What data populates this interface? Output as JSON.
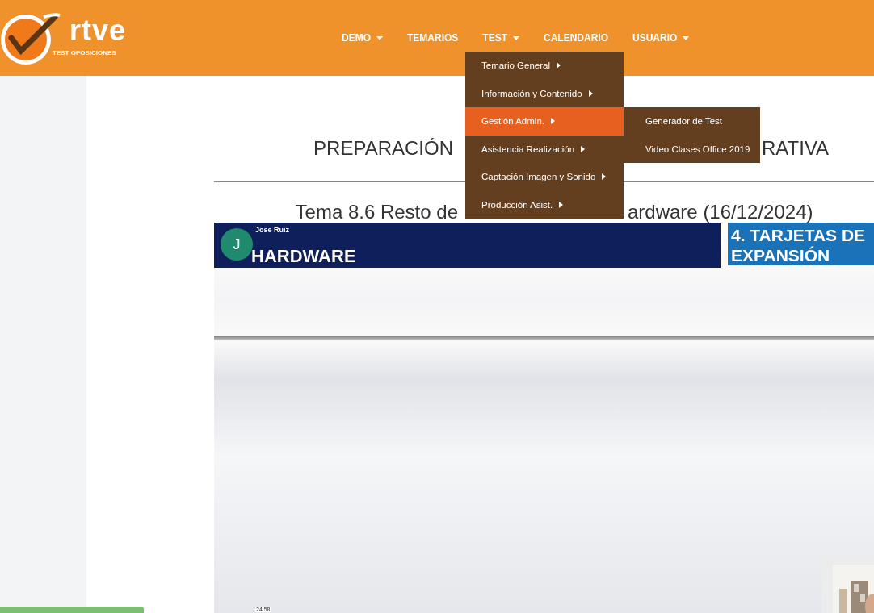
{
  "logo": {
    "wordmark": "rtve",
    "tagline": "TEST OPOSICIONES"
  },
  "nav": [
    {
      "label": "DEMO",
      "caret": true
    },
    {
      "label": "TEMARIOS",
      "caret": false
    },
    {
      "label": "TEST",
      "caret": true
    },
    {
      "label": "CALENDARIO",
      "caret": false
    },
    {
      "label": "USUARIO",
      "caret": true
    }
  ],
  "dropdown": {
    "items": [
      {
        "label": "Temario General",
        "selected": false
      },
      {
        "label": "Información y Contenido",
        "selected": false
      },
      {
        "label": "Gestión Admin.",
        "selected": true,
        "children": [
          {
            "label": "Generador de Test"
          },
          {
            "label": "Video Clases Office 2019"
          }
        ]
      },
      {
        "label": "Asistencia Realización",
        "selected": false
      },
      {
        "label": "Captación Imagen y Sonido",
        "selected": false
      },
      {
        "label": "Producción Asist.",
        "selected": false
      }
    ]
  },
  "page": {
    "title_parts": [
      "PREPARACIÓN",
      "RATIVA"
    ],
    "subtitle_parts": [
      "Tema 8.6 Resto de",
      "ardware (16/12/2024)"
    ]
  },
  "video": {
    "presenter_initial": "J",
    "presenter_name": "Jose Ruiz",
    "slide_title": "HARDWARE",
    "side_heading": [
      "4. TARJETAS DE",
      "EXPANSIÓN"
    ],
    "time": "24:58"
  }
}
